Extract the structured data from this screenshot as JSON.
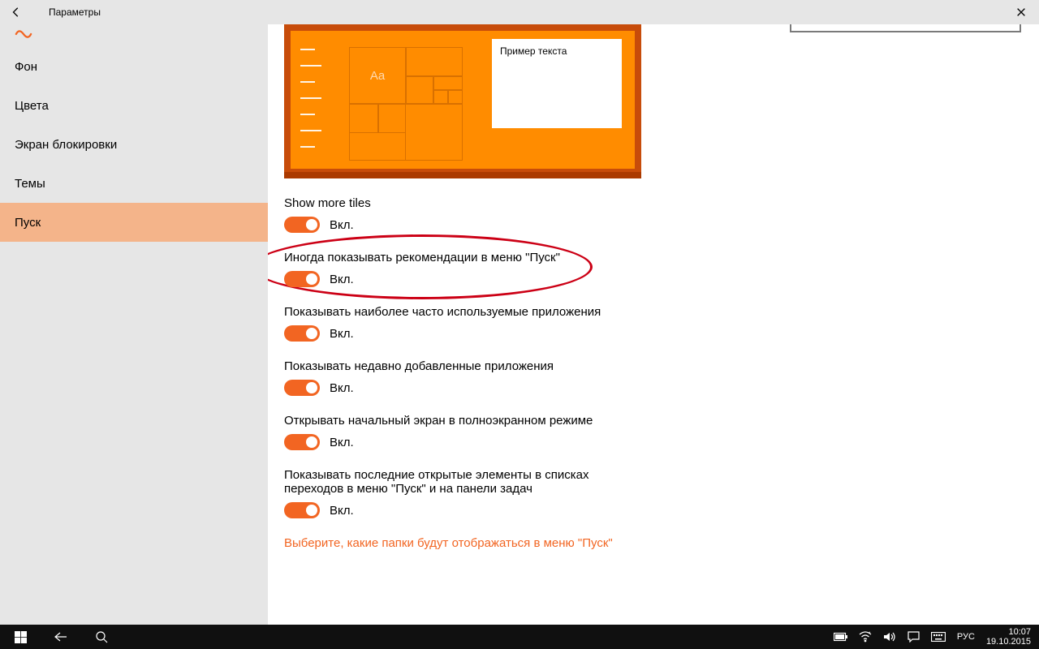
{
  "window": {
    "title": "Параметры"
  },
  "sidebar": {
    "items": [
      {
        "label": "Фон"
      },
      {
        "label": "Цвета"
      },
      {
        "label": "Экран блокировки"
      },
      {
        "label": "Темы"
      },
      {
        "label": "Пуск"
      }
    ],
    "active_index": 4
  },
  "preview": {
    "sample_text": "Пример текста",
    "tile_label": "Aa"
  },
  "settings": [
    {
      "label": "Show more tiles",
      "state": "Вкл."
    },
    {
      "label": "Иногда показывать рекомендации в меню \"Пуск\"",
      "state": "Вкл.",
      "highlighted": true
    },
    {
      "label": "Показывать наиболее часто используемые приложения",
      "state": "Вкл."
    },
    {
      "label": "Показывать недавно добавленные приложения",
      "state": "Вкл."
    },
    {
      "label": "Открывать начальный экран в полноэкранном режиме",
      "state": "Вкл."
    },
    {
      "label": "Показывать последние открытые элементы в списках переходов в меню \"Пуск\" и на панели задач",
      "state": "Вкл."
    }
  ],
  "link": "Выберите, какие папки будут отображаться в меню \"Пуск\"",
  "taskbar": {
    "lang": "РУС",
    "time": "10:07",
    "date": "19.10.2015"
  },
  "colors": {
    "accent": "#f26522"
  }
}
